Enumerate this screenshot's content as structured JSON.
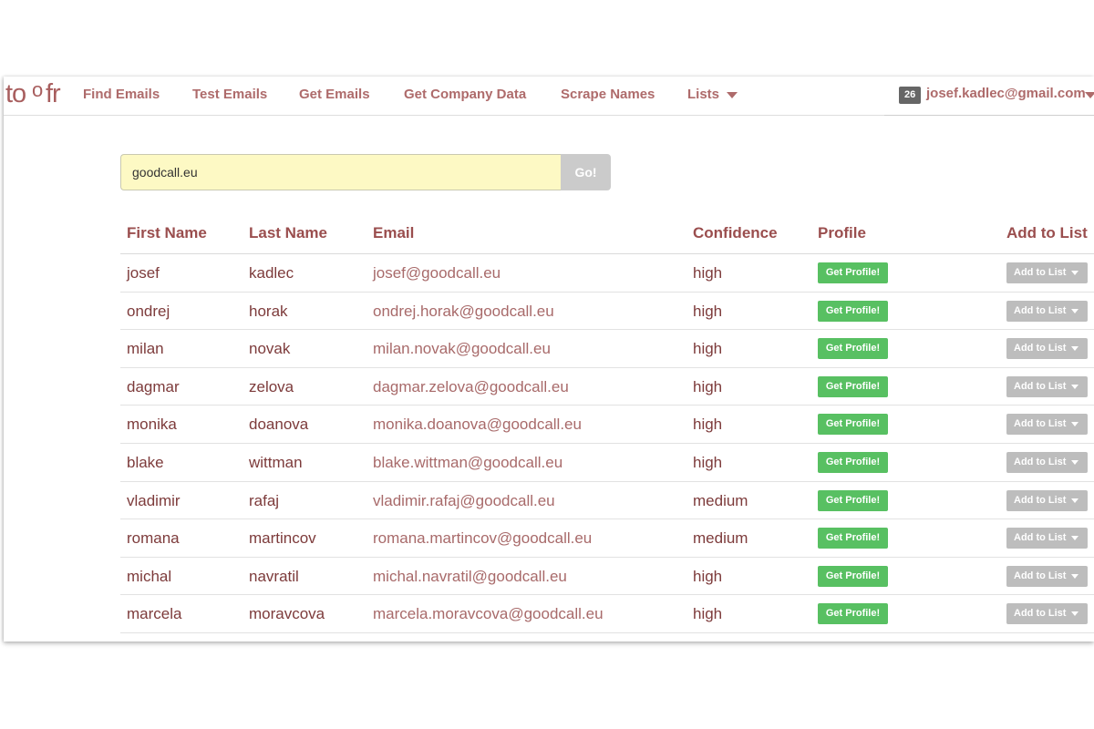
{
  "app": {
    "logo": "toofr"
  },
  "nav": {
    "items": [
      "Find Emails",
      "Test Emails",
      "Get Emails",
      "Get Company Data",
      "Scrape Names",
      "Lists"
    ]
  },
  "user": {
    "count": "26",
    "email": "josef.kadlec@gmail.com"
  },
  "search": {
    "value": "goodcall.eu",
    "placeholder": "",
    "button": "Go!"
  },
  "table": {
    "headers": [
      "First Name",
      "Last Name",
      "Email",
      "Confidence",
      "Profile",
      "Add to List"
    ],
    "profile_button": "Get Profile!",
    "list_button": "Add to List",
    "rows": [
      {
        "first": "josef",
        "last": "kadlec",
        "email": "josef@goodcall.eu",
        "confidence": "high"
      },
      {
        "first": "ondrej",
        "last": "horak",
        "email": "ondrej.horak@goodcall.eu",
        "confidence": "high"
      },
      {
        "first": "milan",
        "last": "novak",
        "email": "milan.novak@goodcall.eu",
        "confidence": "high"
      },
      {
        "first": "dagmar",
        "last": "zelova",
        "email": "dagmar.zelova@goodcall.eu",
        "confidence": "high"
      },
      {
        "first": "monika",
        "last": "doanova",
        "email": "monika.doanova@goodcall.eu",
        "confidence": "high"
      },
      {
        "first": "blake",
        "last": "wittman",
        "email": "blake.wittman@goodcall.eu",
        "confidence": "high"
      },
      {
        "first": "vladimir",
        "last": "rafaj",
        "email": "vladimir.rafaj@goodcall.eu",
        "confidence": "medium"
      },
      {
        "first": "romana",
        "last": "martincov",
        "email": "romana.martincov@goodcall.eu",
        "confidence": "medium"
      },
      {
        "first": "michal",
        "last": "navratil",
        "email": "michal.navratil@goodcall.eu",
        "confidence": "high"
      },
      {
        "first": "marcela",
        "last": "moravcova",
        "email": "marcela.moravcova@goodcall.eu",
        "confidence": "high"
      }
    ]
  },
  "colors": {
    "accent": "#ae6b6b",
    "profile_green": "#58c062",
    "input_bg": "#fdf9c4"
  }
}
